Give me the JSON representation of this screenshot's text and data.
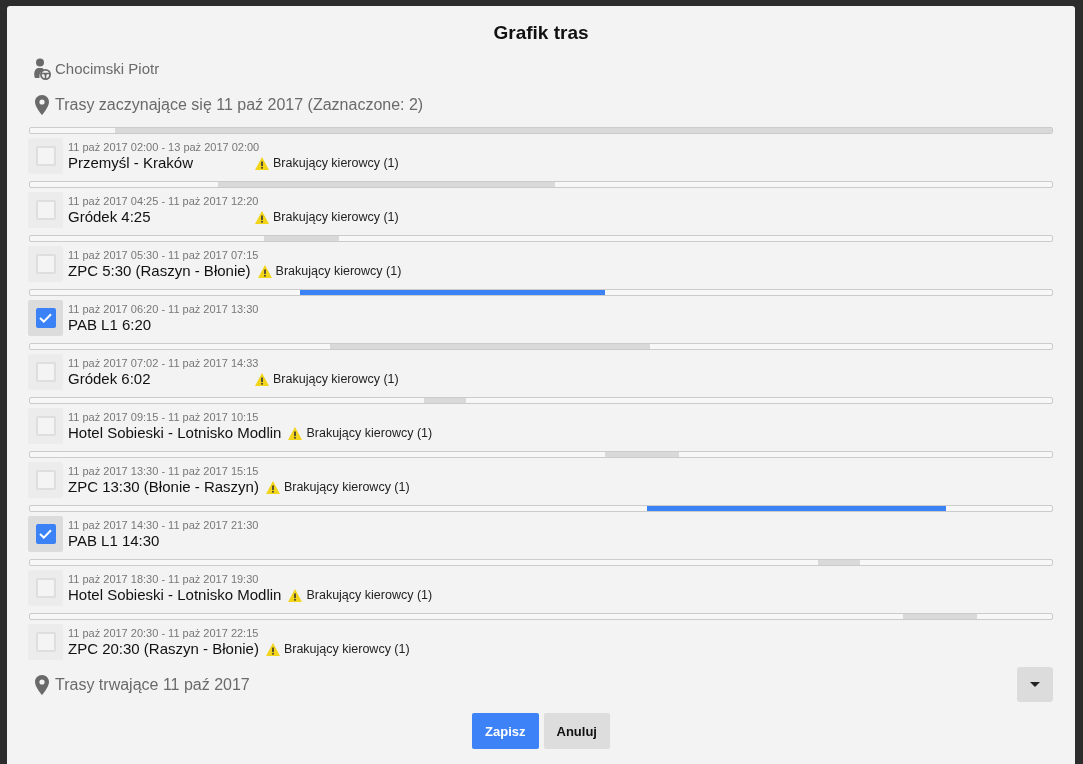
{
  "dialog": {
    "title": "Grafik tras"
  },
  "driver": {
    "name": "Chocimski Piotr"
  },
  "starting_routes": {
    "heading": "Trasy zaczynające się 11 paź 2017 (Zaznaczone: 2)",
    "routes": [
      {
        "time": "11 paż 2017 02:00 - 13 paż 2017 02:00",
        "name": "Przemyśl - Kraków",
        "checked": false,
        "warning": "Brakujący kierowcy (1)"
      },
      {
        "time": "11 paż 2017 04:25 - 11 paż 2017 12:20",
        "name": "Gródek 4:25",
        "checked": false,
        "warning": "Brakujący kierowcy (1)"
      },
      {
        "time": "11 paż 2017 05:30 - 11 paż 2017 07:15",
        "name": "ZPC 5:30 (Raszyn - Błonie)",
        "checked": false,
        "warning": "Brakujący kierowcy (1)"
      },
      {
        "time": "11 paż 2017 06:20 - 11 paż 2017 13:30",
        "name": "PAB L1 6:20",
        "checked": true
      },
      {
        "time": "11 paż 2017 07:02 - 11 paż 2017 14:33",
        "name": "Gródek 6:02",
        "checked": false,
        "warning": "Brakujący kierowcy (1)"
      },
      {
        "time": "11 paż 2017 09:15 - 11 paż 2017 10:15",
        "name": "Hotel Sobieski - Lotnisko Modlin",
        "checked": false,
        "warning": "Brakujący kierowcy (1)"
      },
      {
        "time": "11 paż 2017 13:30 - 11 paż 2017 15:15",
        "name": "ZPC 13:30 (Błonie - Raszyn)",
        "checked": false,
        "warning": "Brakujący kierowcy (1)"
      },
      {
        "time": "11 paż 2017 14:30 - 11 paż 2017 21:30",
        "name": "PAB L1 14:30",
        "checked": true
      },
      {
        "time": "11 paż 2017 18:30 - 11 paż 2017 19:30",
        "name": "Hotel Sobieski - Lotnisko Modlin",
        "checked": false,
        "warning": "Brakujący kierowcy (1)"
      },
      {
        "time": "11 paż 2017 20:30 - 11 paż 2017 22:15",
        "name": "ZPC 20:30 (Raszyn - Błonie)",
        "checked": false,
        "warning": "Brakujący kierowcy (1)"
      }
    ]
  },
  "ongoing_routes": {
    "heading": "Trasy trwające 11 paź 2017",
    "expanded": false
  },
  "buttons": [
    {
      "label": "Zapisz",
      "kind": "primary"
    },
    {
      "label": "Anuluj",
      "kind": "secondary"
    }
  ]
}
